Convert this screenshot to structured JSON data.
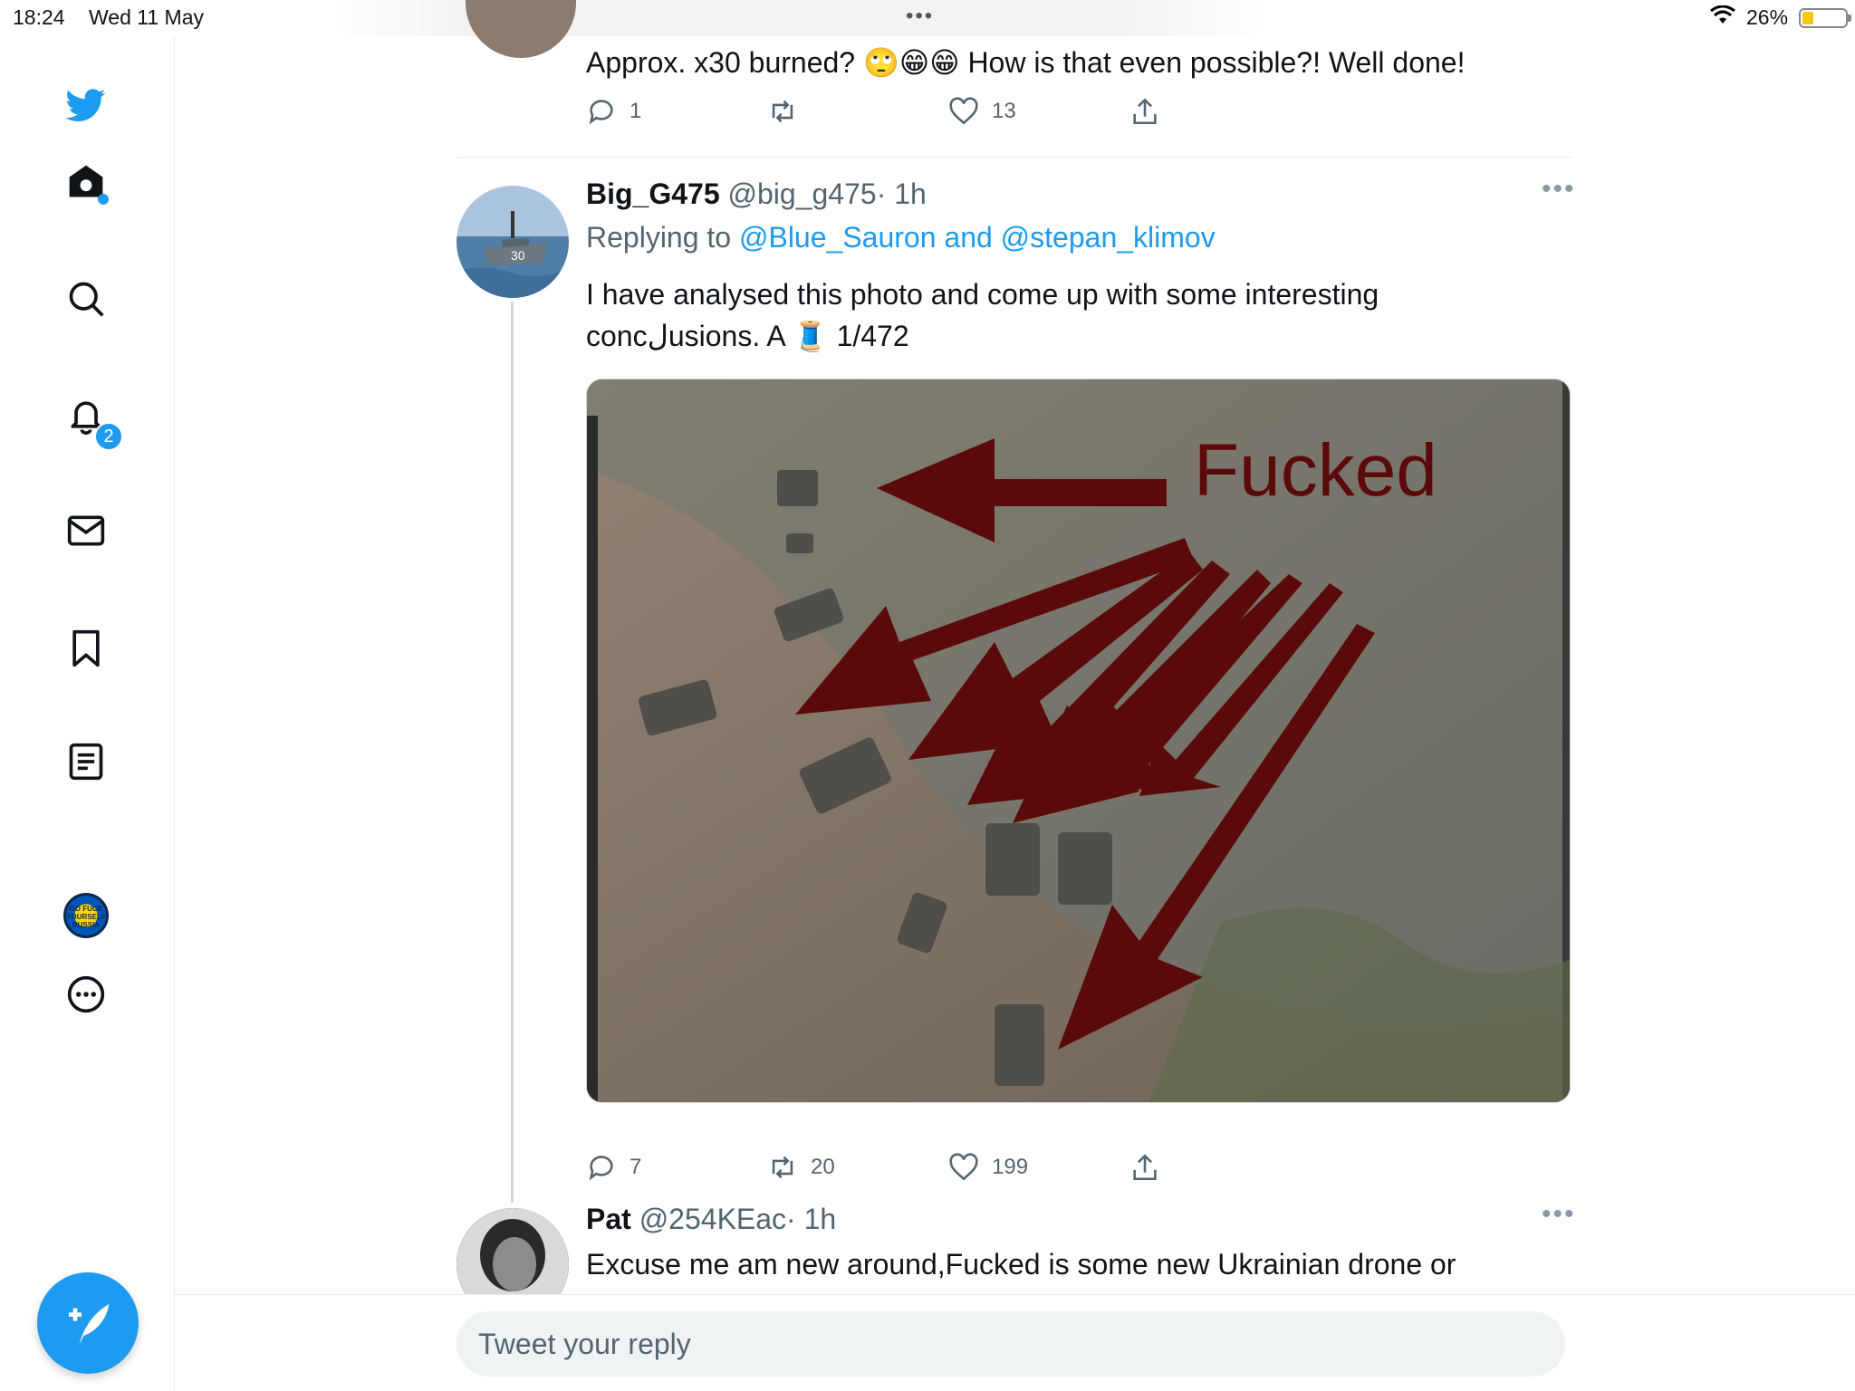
{
  "status_bar": {
    "time": "18:24",
    "date": "Wed 11 May",
    "battery_percent": "26%",
    "battery_level": 0.26,
    "multitask_dots": "•••"
  },
  "sidebar": {
    "items": [
      {
        "name": "twitter-logo",
        "icon": "twitter-bird-icon"
      },
      {
        "name": "home",
        "icon": "home-icon"
      },
      {
        "name": "explore",
        "icon": "search-icon"
      },
      {
        "name": "notifications",
        "icon": "bell-icon",
        "badge": "2"
      },
      {
        "name": "messages",
        "icon": "mail-icon"
      },
      {
        "name": "bookmarks",
        "icon": "bookmark-icon"
      },
      {
        "name": "lists",
        "icon": "list-icon"
      },
      {
        "name": "profile",
        "icon": "profile-avatar"
      },
      {
        "name": "more",
        "icon": "more-circle-icon"
      }
    ],
    "profile_badge_text": "GO FUCK YOURSELF RUSSIA",
    "accent_color": "#1d9bf0"
  },
  "tweets": [
    {
      "text": "Approx. x30 burned? 🙄😁😁 How is that even possible?! Well done!",
      "reply_count": "1",
      "retweet_count": "",
      "like_count": "13"
    },
    {
      "display_name": "Big_G475",
      "handle": "@big_g475",
      "time": "· 1h",
      "replying_prefix": "Replying to",
      "replying_to": "@Blue_Sauron and @stepan_klimov",
      "text_line1": "I have analysed this photo and come up with some interesting",
      "text_line2": "concلusions. A 🧵 1/472",
      "image_label": "Fucked",
      "reply_count": "7",
      "retweet_count": "20",
      "like_count": "199"
    },
    {
      "display_name": "Pat",
      "handle": "@254KEac",
      "time": "· 1h",
      "text": "Excuse me am new around,Fucked is some new Ukrainian drone or"
    }
  ],
  "reply_box": {
    "placeholder": "Tweet your reply"
  }
}
